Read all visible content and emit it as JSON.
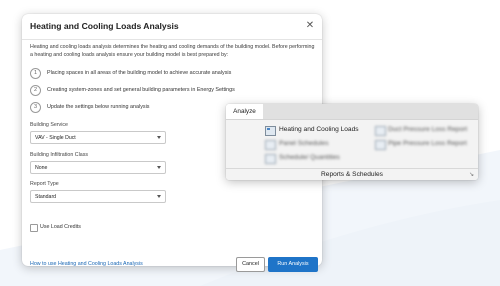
{
  "dialog": {
    "title": "Heating and Cooling Loads Analysis",
    "intro": "Heating and cooling loads analysis determines the heating and cooling demands of the building model. Before performing a heating and cooling loads analysis ensure your building model is best prepared by:",
    "steps": [
      {
        "num": "1",
        "text": "Placing spaces in all areas of the building model to achieve accurate analysis"
      },
      {
        "num": "2",
        "text": "Creating system-zones and set general building parameters in Energy Settings"
      },
      {
        "num": "3",
        "text": "Update the settings below running analysis"
      }
    ],
    "fields": {
      "service_label": "Building Service",
      "service_value": "VAV - Single Duct",
      "infiltration_label": "Building Infiltration Class",
      "infiltration_value": "None",
      "report_label": "Report Type",
      "report_value": "Standard"
    },
    "use_load_credits": "Use Load Credits",
    "help_link": "How to use Heating and Cooling Loads Analysis",
    "cancel": "Cancel",
    "run": "Run Analysis"
  },
  "ribbon": {
    "tab": "Analyze",
    "items": [
      {
        "label": "Heating and  Cooling Loads",
        "icon": "loads-icon",
        "clear": true
      },
      {
        "label": "Duct Pressure  Loss Report",
        "icon": "duct-report-icon",
        "clear": false
      },
      {
        "label": "Panel  Schedules",
        "icon": "panel-schedule-icon",
        "clear": false
      },
      {
        "label": "Pipe Pressure  Loss Report",
        "icon": "pipe-report-icon",
        "clear": false
      },
      {
        "label": "Schedule/  Quantities",
        "icon": "schedule-icon",
        "clear": false
      }
    ],
    "footer": "Reports & Schedules"
  }
}
